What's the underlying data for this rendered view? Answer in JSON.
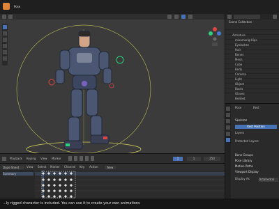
{
  "toolbar": {
    "menu_items": [
      "",
      "",
      "",
      ""
    ],
    "mode_label": "Pose"
  },
  "outliner": {
    "title": "Scene Collection",
    "items": [
      "Armature",
      "mixamorig:Hips",
      "Eyelashes",
      "Hair",
      "Bones",
      "Mesh",
      "Cube",
      "Body",
      "Camera",
      "Light",
      "Object",
      "Boots",
      "Gloves",
      "Helmet"
    ]
  },
  "properties": {
    "tab_pose": "Pose",
    "tab_rest": "Rest",
    "section_skeleton": "Skeleton",
    "rest_pose_button": "Rest Position",
    "layers_label": "Layers",
    "protected_layers_label": "Protected Layers",
    "bone_groups_label": "Bone Groups",
    "pose_library_label": "Pose Library",
    "motion_paths_label": "Motion Paths",
    "viewport_display_label": "Viewport Display",
    "display_as_label": "Display As",
    "display_as_value": "Octahedral"
  },
  "timeline": {
    "playback_label": "Playback",
    "keying_label": "Keying",
    "view_label": "View",
    "marker_label": "Marker",
    "current_frame": "1",
    "start_frame": "1",
    "end_frame": "250"
  },
  "dopesheet": {
    "mode": "Dope Sheet",
    "view_label": "View",
    "select_label": "Select",
    "marker_label": "Marker",
    "channel_label": "Channel",
    "key_label": "Key",
    "action_label": "Action",
    "new_button": "New",
    "summary_label": "Summary"
  },
  "status": {
    "message": "...ly rigged character is included. You can use it to create your own animations"
  },
  "colors": {
    "accent": "#4772b3",
    "keyframe": "#e0e0e0",
    "circle": "#d9d95f",
    "bone_green": "#2fd07a",
    "bone_red": "#e14646"
  }
}
